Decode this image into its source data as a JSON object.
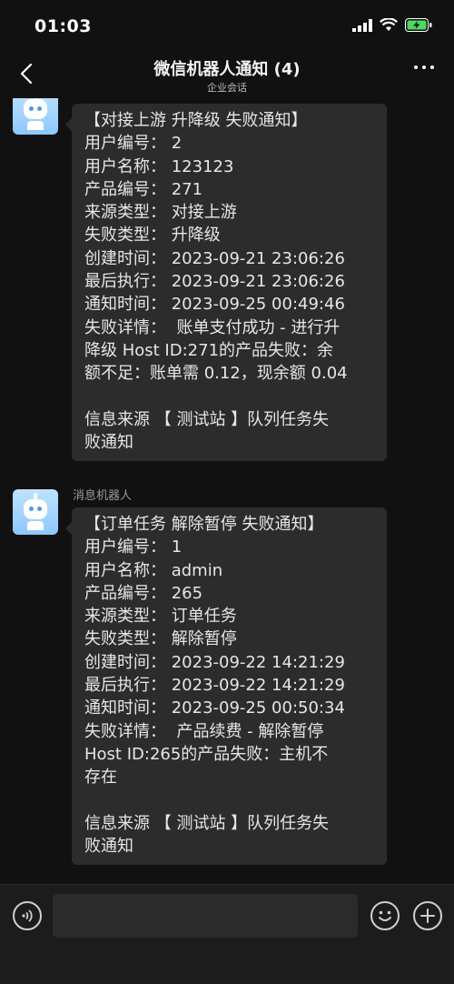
{
  "status_bar": {
    "time": "01:03",
    "icons": [
      "signal-icon",
      "wifi-icon",
      "battery-charging-icon"
    ]
  },
  "nav": {
    "title": "微信机器人通知 (4)",
    "subtitle": "企业会话",
    "back_icon": "chevron-left-icon",
    "more_icon": "more-dots-icon"
  },
  "messages": [
    {
      "sender": "",
      "lines": [
        "【对接上游 升降级 失败通知】",
        "用户编号： 2",
        "用户名称： 123123",
        "产品编号： 271",
        "来源类型： 对接上游",
        "失败类型： 升降级",
        "创建时间： 2023-09-21 23:06:26",
        "最后执行： 2023-09-21 23:06:26",
        "通知时间： 2023-09-25 00:49:46",
        "失败详情：  账单支付成功 - 进行升",
        "降级 Host ID:271的产品失败：余",
        "额不足：账单需 0.12，现余额 0.04",
        "",
        "信息来源 【 测试站 】队列任务失",
        "败通知"
      ]
    },
    {
      "sender": "消息机器人",
      "lines": [
        "【订单任务 解除暂停 失败通知】",
        "用户编号： 1",
        "用户名称： admin",
        "产品编号： 265",
        "来源类型： 订单任务",
        "失败类型： 解除暂停",
        "创建时间： 2023-09-22 14:21:29",
        "最后执行： 2023-09-22 14:21:29",
        "通知时间： 2023-09-25 00:50:34",
        "失败详情：  产品续费 - 解除暂停",
        "Host ID:265的产品失败：主机不",
        "存在",
        "",
        "信息来源 【 测试站 】队列任务失",
        "败通知"
      ]
    }
  ],
  "input_bar": {
    "text_value": "",
    "voice_icon": "voice-icon",
    "emoji_icon": "emoji-icon",
    "plus_icon": "plus-icon"
  }
}
